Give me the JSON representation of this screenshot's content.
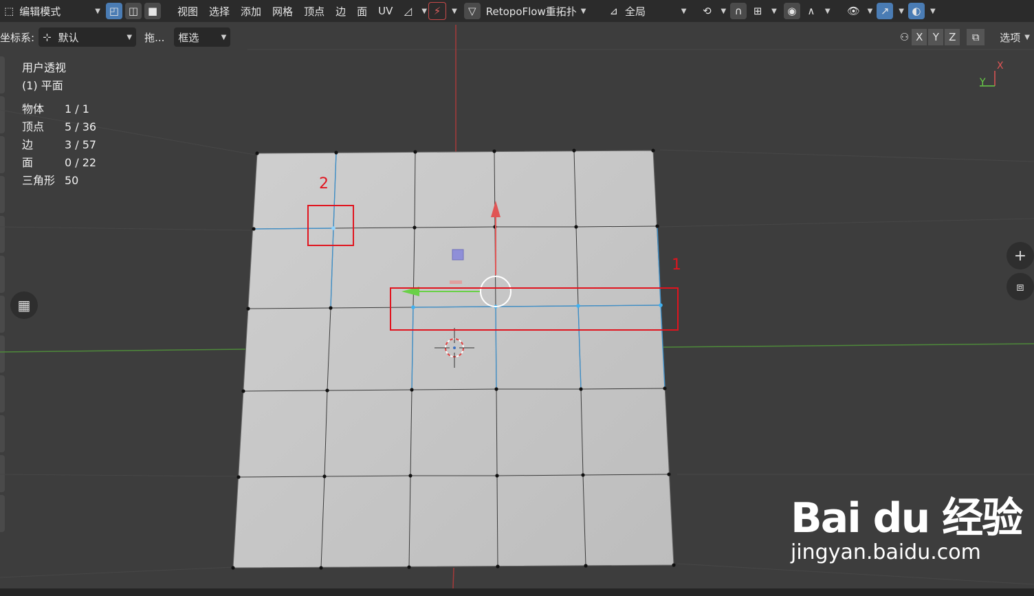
{
  "header": {
    "mode": "编辑模式",
    "menus": [
      "视图",
      "选择",
      "添加",
      "网格",
      "顶点",
      "边",
      "面",
      "UV"
    ],
    "addon": "RetopoFlow重拓扑",
    "transform_orientation": "全局"
  },
  "subheader": {
    "coord_label": "坐标系:",
    "coord_value": "默认",
    "drag_label": "拖...",
    "select_mode": "框选",
    "axes": [
      "X",
      "Y",
      "Z"
    ],
    "options": "选项"
  },
  "overlay": {
    "view": "用户透视",
    "object": "(1) 平面",
    "stats": [
      {
        "label": "物体",
        "value": "1 / 1"
      },
      {
        "label": "顶点",
        "value": "5 / 36"
      },
      {
        "label": "边",
        "value": "3 / 57"
      },
      {
        "label": "面",
        "value": "0 / 22"
      },
      {
        "label": "三角形",
        "value": "50"
      }
    ]
  },
  "annotations": {
    "one": "1",
    "two": "2"
  },
  "gizmo": {
    "x": "X",
    "y": "Y"
  },
  "watermark": {
    "logo": "Bai du 经验",
    "url": "jingyan.baidu.com"
  },
  "colors": {
    "accent": "#4a7cb4",
    "annotation": "#e0141e",
    "mesh": "#c6c6c6",
    "background": "#3d3d3d"
  }
}
